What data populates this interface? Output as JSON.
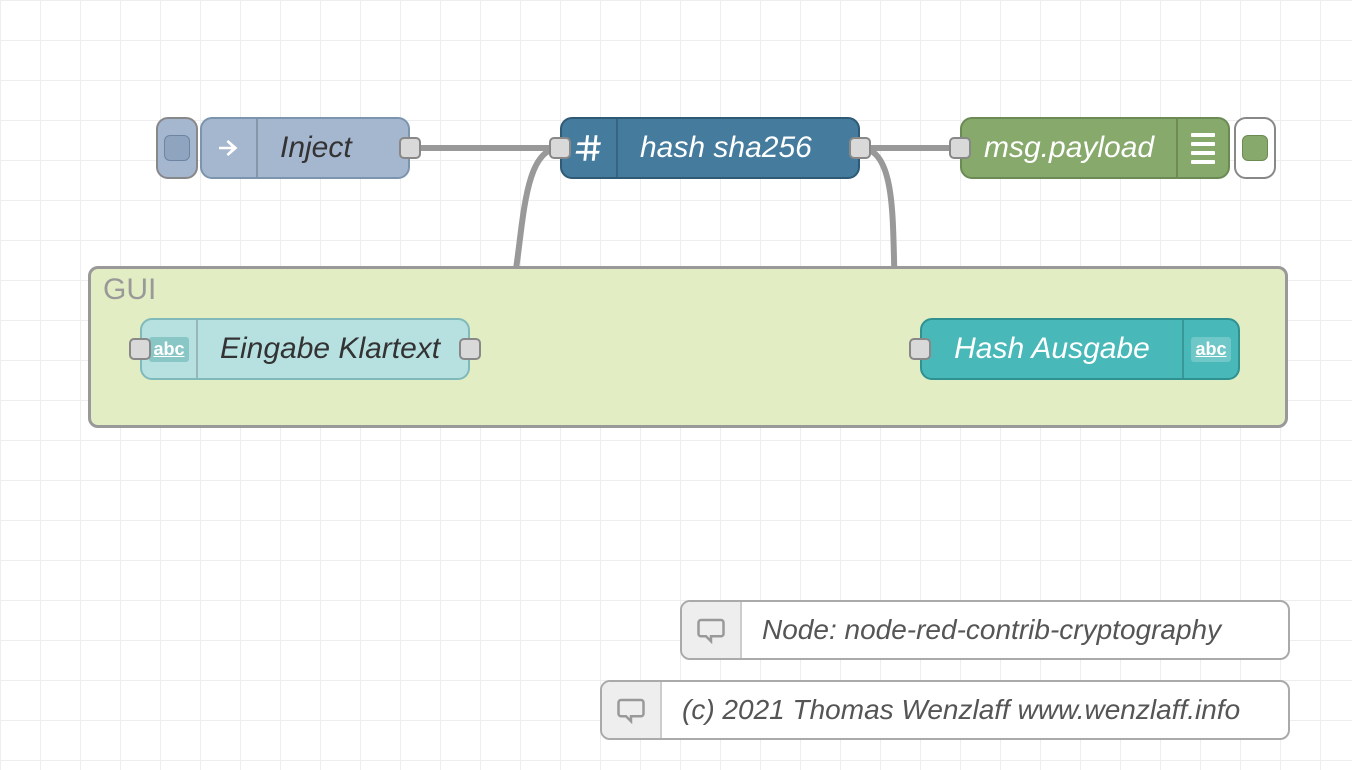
{
  "nodes": {
    "inject": {
      "label": "Inject"
    },
    "hash": {
      "label": "hash sha256"
    },
    "debug": {
      "label": "msg.payload"
    },
    "textin": {
      "label": "Eingabe Klartext"
    },
    "textout": {
      "label": "Hash Ausgabe"
    }
  },
  "group": {
    "label": "GUI"
  },
  "comments": {
    "c1": "Node: node-red-contrib-cryptography",
    "c2": "(c) 2021 Thomas Wenzlaff www.wenzlaff.info"
  }
}
